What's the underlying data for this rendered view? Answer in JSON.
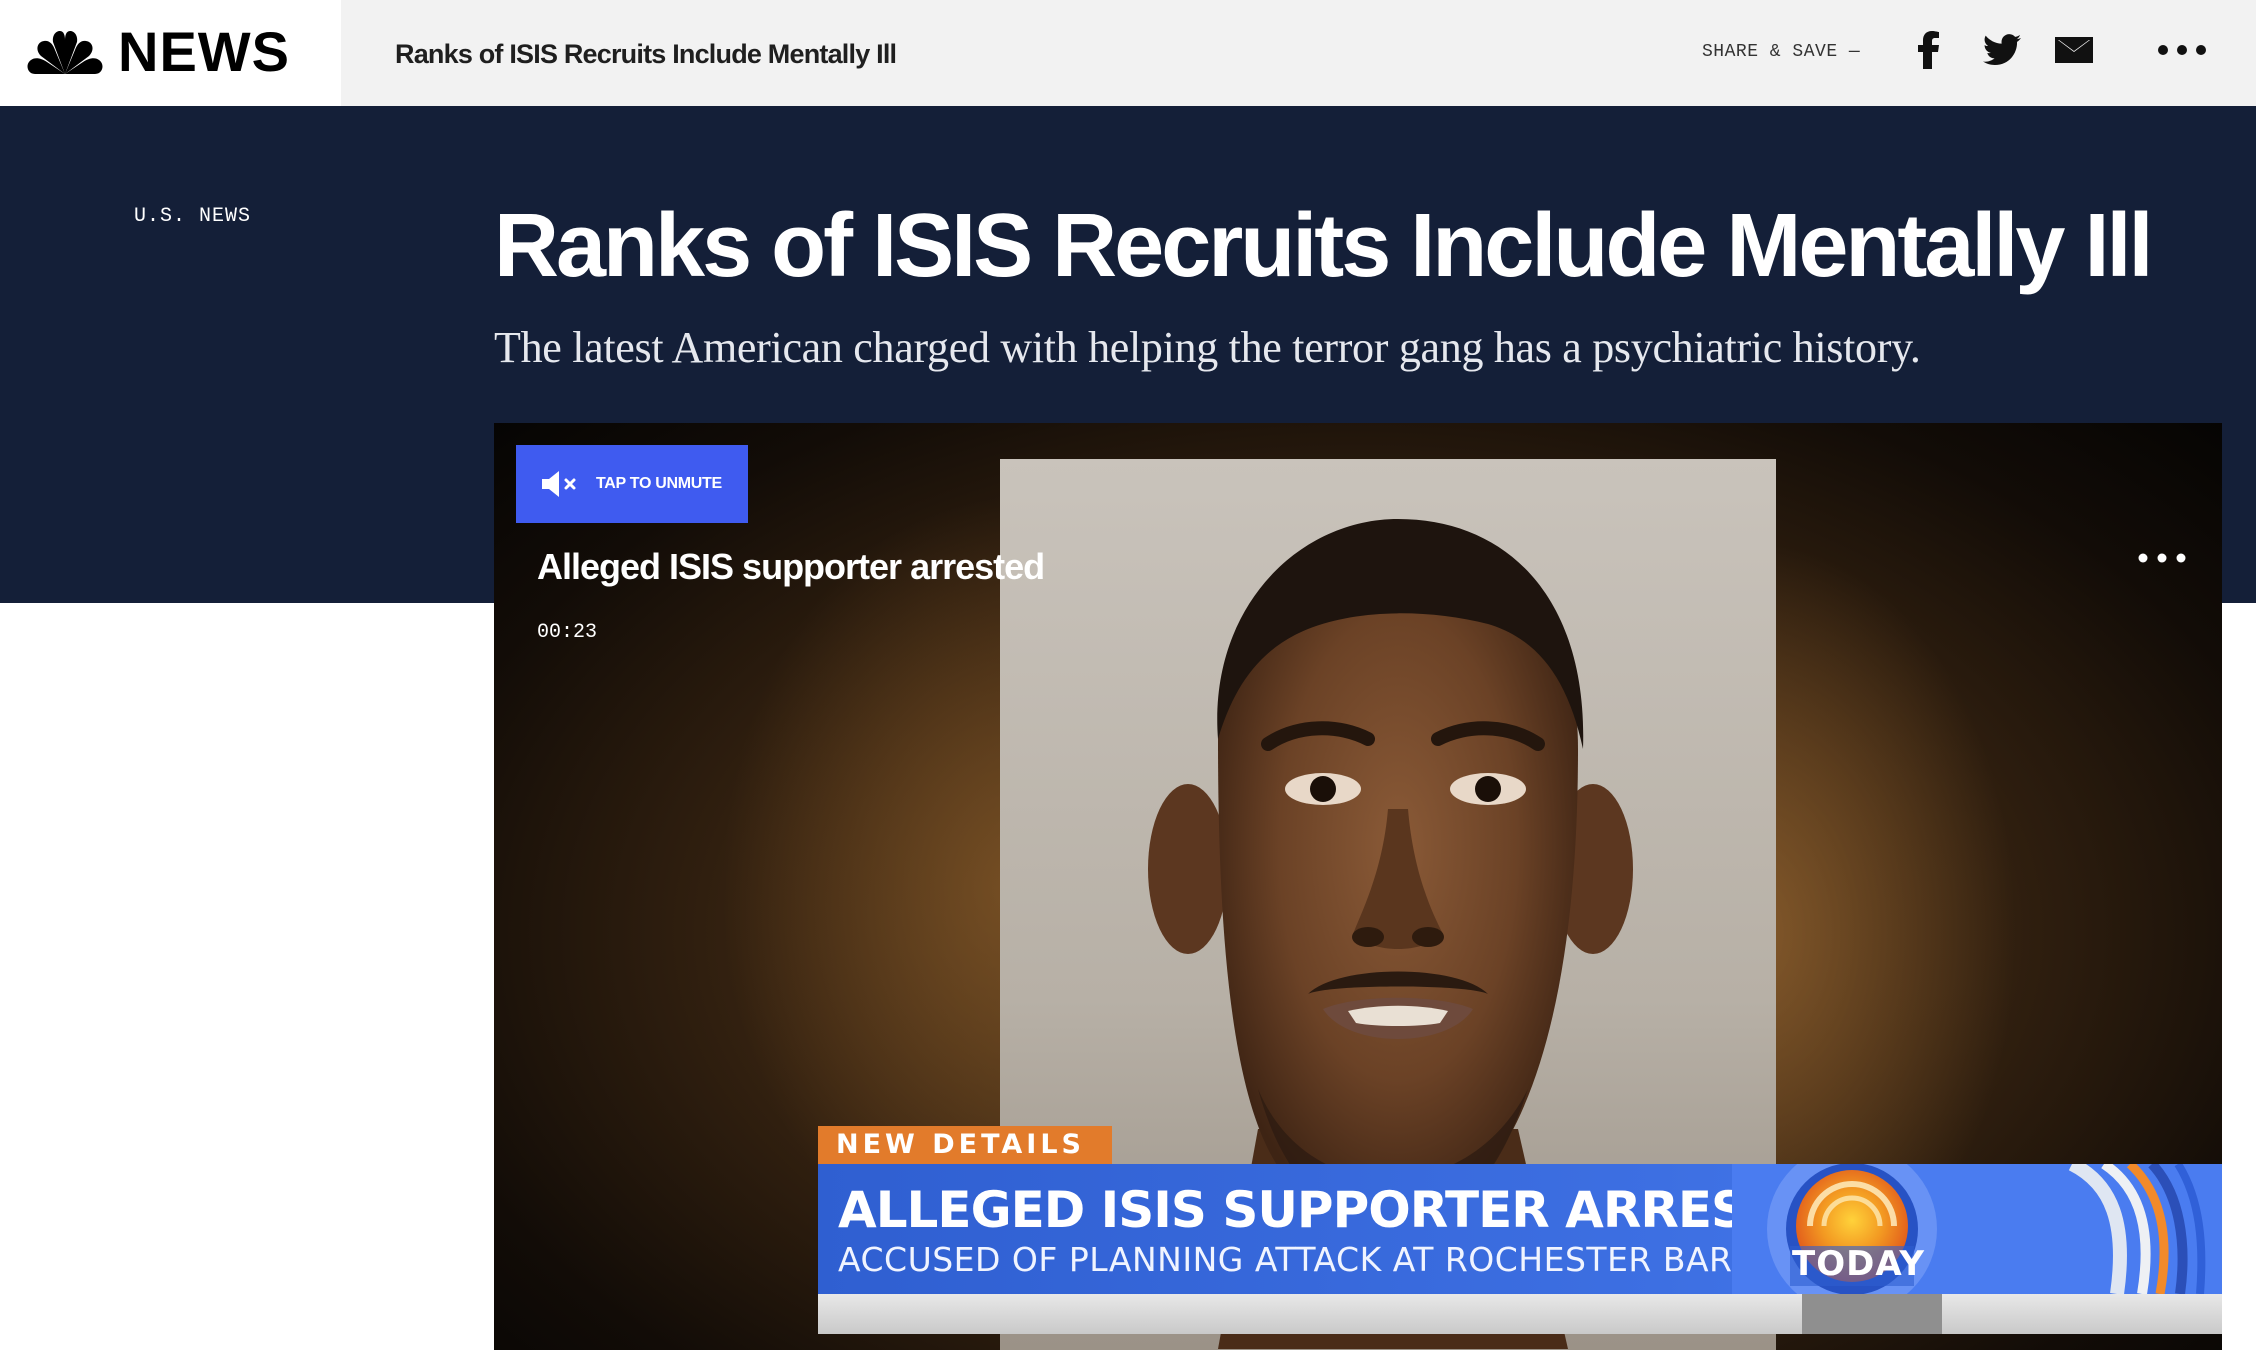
{
  "brand": {
    "logo_text": "NEWS",
    "logo_icon": "nbc-peacock-icon"
  },
  "topbar": {
    "title": "Ranks of ISIS Recruits Include Mentally Ill",
    "share_label": "SHARE & SAVE —",
    "icons": [
      "facebook-icon",
      "twitter-icon",
      "email-icon",
      "more-icon"
    ]
  },
  "article": {
    "section": "U.S. NEWS",
    "headline": "Ranks of ISIS Recruits Include Mentally Ill",
    "dek": "The latest American charged with helping the terror gang has a psychiatric history."
  },
  "video": {
    "unmute_label": "TAP TO UNMUTE",
    "title": "Alleged ISIS supporter arrested",
    "duration": "00:23",
    "lower_third": {
      "tag": "NEW DETAILS",
      "headline": "ALLEGED ISIS SUPPORTER ARRESTED",
      "subhead": "ACCUSED OF PLANNING ATTACK AT ROCHESTER BAR",
      "show_logo": "TODAY"
    }
  },
  "colors": {
    "hero_bg": "#141f38",
    "topbar_bg": "#f2f2f2",
    "unmute_bg": "#3f5bf0",
    "lower_third_blue": "#3d6fe2",
    "lower_third_orange": "#e27b2b"
  }
}
